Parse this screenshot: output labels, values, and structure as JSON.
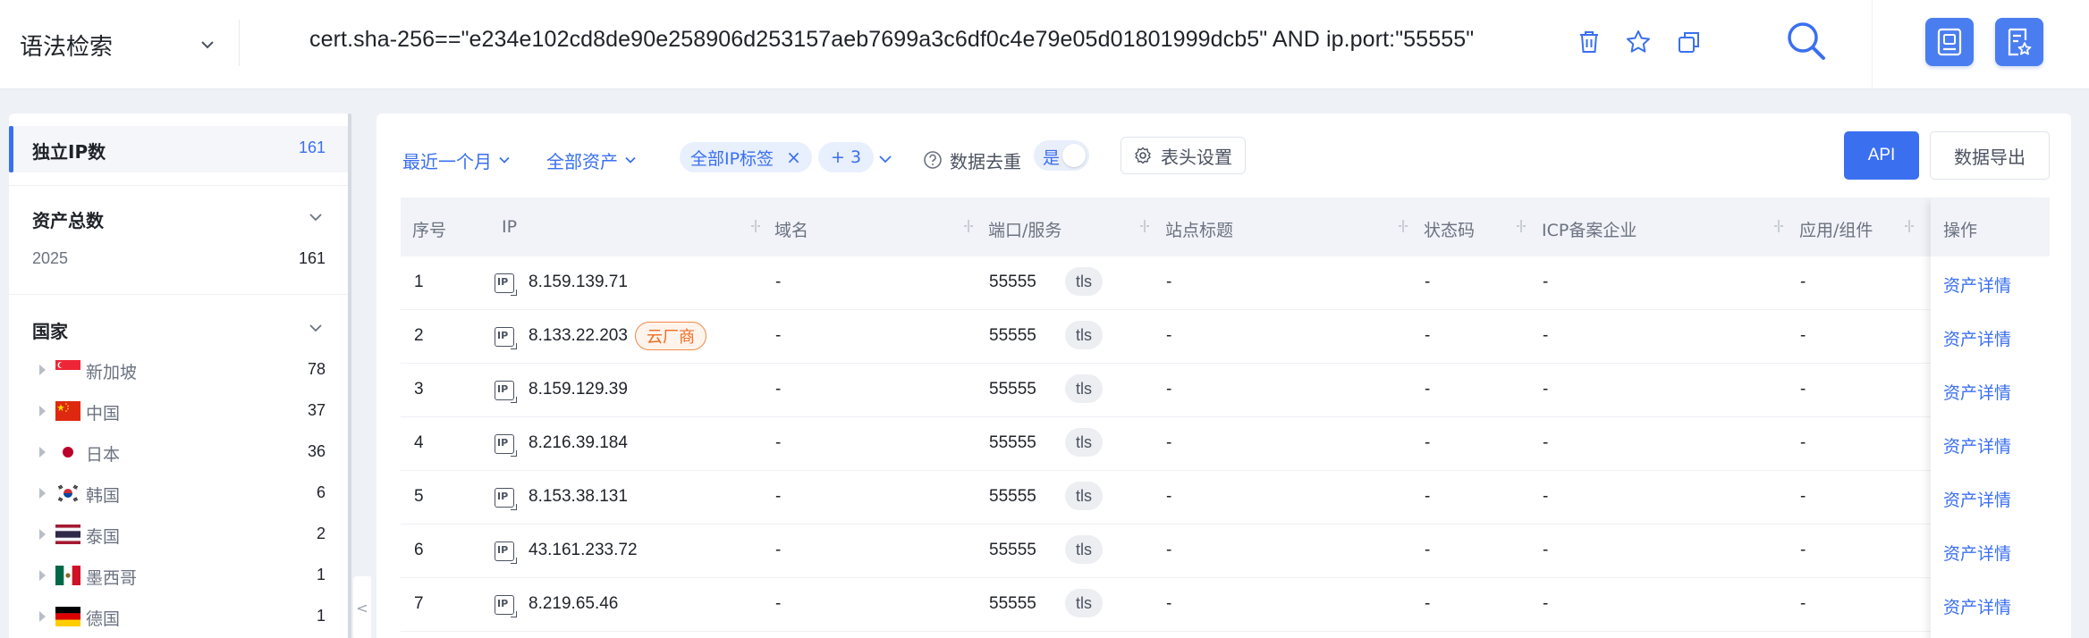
{
  "topbar": {
    "mode_label": "语法检索",
    "query": "cert.sha-256==\"e234e102cd8de90e258906d253157aeb7699a3c6df0c4e79e05d01801999dcb5\" AND ip.port:\"55555\""
  },
  "sidebar": {
    "unique_ip": {
      "label": "独立IP数",
      "count": "161"
    },
    "total_assets": {
      "label": "资产总数",
      "year": "2025",
      "count": "161"
    },
    "country_title": "国家",
    "countries": [
      {
        "name": "新加坡",
        "count": "78",
        "flag": "sg"
      },
      {
        "name": "中国",
        "count": "37",
        "flag": "cn"
      },
      {
        "name": "日本",
        "count": "36",
        "flag": "jp"
      },
      {
        "name": "韩国",
        "count": "6",
        "flag": "kr"
      },
      {
        "name": "泰国",
        "count": "2",
        "flag": "th"
      },
      {
        "name": "墨西哥",
        "count": "1",
        "flag": "mx"
      },
      {
        "name": "德国",
        "count": "1",
        "flag": "de"
      }
    ],
    "collapse_glyph": "<"
  },
  "toolbar": {
    "time_filter": "最近一个月",
    "asset_filter": "全部资产",
    "ip_tag": "全部IP标签",
    "tag_close": "×",
    "more_tags": "+ 3",
    "dedup_label": "数据去重",
    "dedup_value": "是",
    "header_settings": "表头设置",
    "api_label": "API",
    "export_label": "数据导出"
  },
  "table": {
    "columns": [
      "序号",
      "IP",
      "域名",
      "端口/服务",
      "站点标题",
      "状态码",
      "ICP备案企业",
      "应用/组件",
      "操作"
    ],
    "ip_icon_text": "IP",
    "rows": [
      {
        "no": "1",
        "ip": "8.159.139.71",
        "badge": "",
        "domain": "-",
        "port": "55555",
        "service": "tls",
        "title": "-",
        "status": "-",
        "icp": "-",
        "app": "-",
        "action": "资产详情"
      },
      {
        "no": "2",
        "ip": "8.133.22.203",
        "badge": "云厂商",
        "domain": "-",
        "port": "55555",
        "service": "tls",
        "title": "-",
        "status": "-",
        "icp": "-",
        "app": "-",
        "action": "资产详情"
      },
      {
        "no": "3",
        "ip": "8.159.129.39",
        "badge": "",
        "domain": "-",
        "port": "55555",
        "service": "tls",
        "title": "-",
        "status": "-",
        "icp": "-",
        "app": "-",
        "action": "资产详情"
      },
      {
        "no": "4",
        "ip": "8.216.39.184",
        "badge": "",
        "domain": "-",
        "port": "55555",
        "service": "tls",
        "title": "-",
        "status": "-",
        "icp": "-",
        "app": "-",
        "action": "资产详情"
      },
      {
        "no": "5",
        "ip": "8.153.38.131",
        "badge": "",
        "domain": "-",
        "port": "55555",
        "service": "tls",
        "title": "-",
        "status": "-",
        "icp": "-",
        "app": "-",
        "action": "资产详情"
      },
      {
        "no": "6",
        "ip": "43.161.233.72",
        "badge": "",
        "domain": "-",
        "port": "55555",
        "service": "tls",
        "title": "-",
        "status": "-",
        "icp": "-",
        "app": "-",
        "action": "资产详情"
      },
      {
        "no": "7",
        "ip": "8.219.65.46",
        "badge": "",
        "domain": "-",
        "port": "55555",
        "service": "tls",
        "title": "-",
        "status": "-",
        "icp": "-",
        "app": "-",
        "action": "资产详情"
      }
    ]
  },
  "colors": {
    "accent": "#3a6ff0",
    "cloud_badge": "#f06b1f",
    "page_bg": "#eef1f6"
  }
}
